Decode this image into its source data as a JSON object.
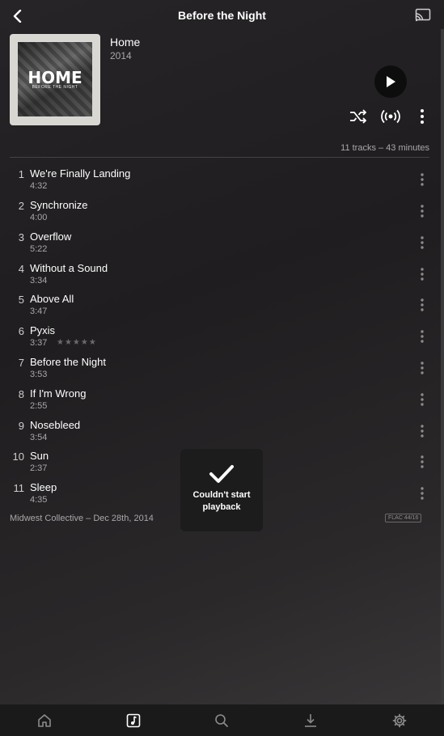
{
  "header": {
    "title": "Before the Night"
  },
  "album": {
    "name": "Home",
    "year": "2014",
    "cover_title": "HOME",
    "cover_subtitle": "BEFORE THE NIGHT"
  },
  "summary": "11 tracks – 43 minutes",
  "tracks": [
    {
      "num": "1",
      "name": "We're Finally Landing",
      "duration": "4:32"
    },
    {
      "num": "2",
      "name": "Synchronize",
      "duration": "4:00"
    },
    {
      "num": "3",
      "name": "Overflow",
      "duration": "5:22"
    },
    {
      "num": "4",
      "name": "Without a Sound",
      "duration": "3:34"
    },
    {
      "num": "5",
      "name": "Above All",
      "duration": "3:47"
    },
    {
      "num": "6",
      "name": "Pyxis",
      "duration": "3:37",
      "stars": "★★★★★"
    },
    {
      "num": "7",
      "name": "Before the Night",
      "duration": "3:53"
    },
    {
      "num": "8",
      "name": "If I'm Wrong",
      "duration": "2:55"
    },
    {
      "num": "9",
      "name": "Nosebleed",
      "duration": "3:54"
    },
    {
      "num": "10",
      "name": "Sun",
      "duration": "2:37"
    },
    {
      "num": "11",
      "name": "Sleep",
      "duration": "4:35"
    }
  ],
  "footer": {
    "label": "Midwest Collective – Dec 28th, 2014",
    "format": "FLAC 44/16"
  },
  "toast": {
    "message": "Couldn't start playback"
  },
  "icons": {
    "back": "arrow-left-icon",
    "cast": "cast-icon",
    "play": "play-icon",
    "shuffle": "shuffle-icon",
    "radio": "radio-icon",
    "more": "more-vertical-icon",
    "check": "check-icon",
    "home": "home-icon",
    "music": "music-note-icon",
    "search": "search-icon",
    "download": "download-icon",
    "settings": "gear-icon"
  },
  "colors": {
    "background": "#262426",
    "secondary_text": "#a9a7a9",
    "toast_bg": "#1c1c1c"
  }
}
